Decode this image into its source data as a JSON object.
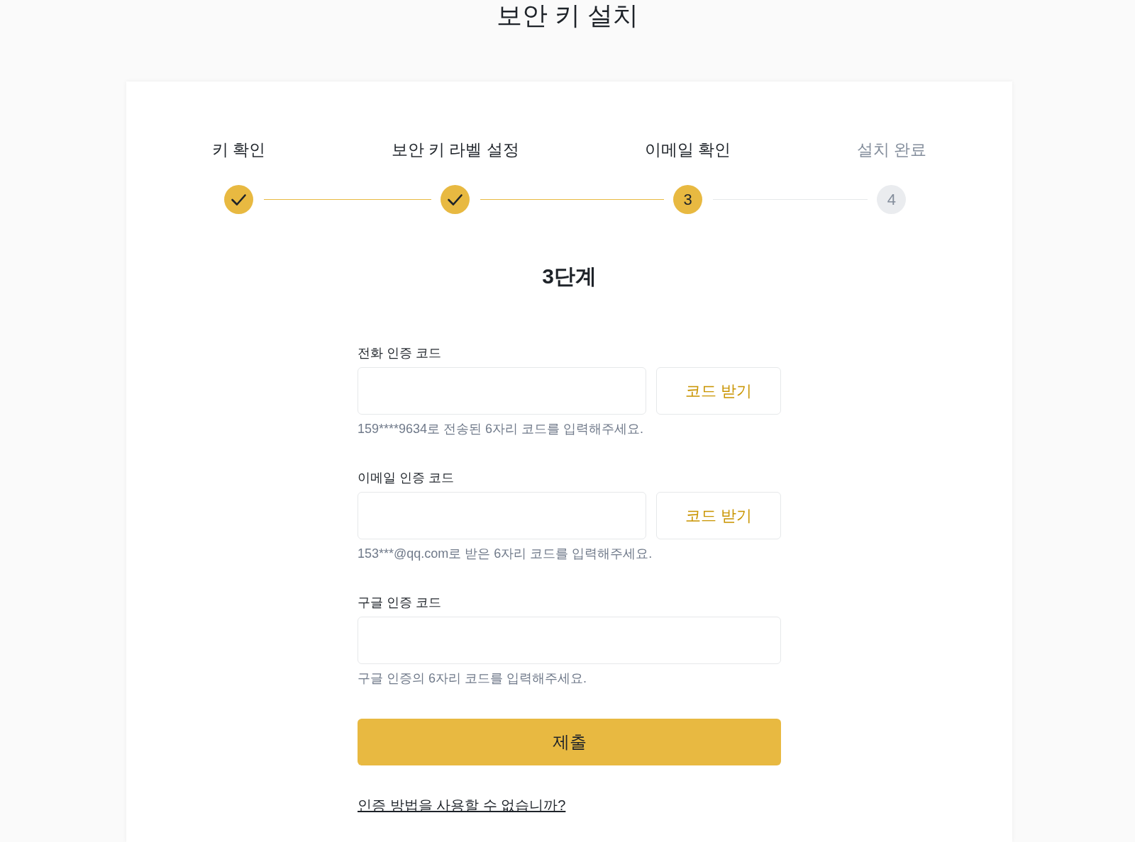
{
  "title": "보안 키 설치",
  "steps": [
    {
      "label": "키 확인",
      "kind": "done"
    },
    {
      "label": "보안 키 라벨 설정",
      "kind": "done"
    },
    {
      "label": "이메일 확인",
      "kind": "current",
      "number": "3"
    },
    {
      "label": "설치 완료",
      "kind": "upcoming",
      "number": "4"
    }
  ],
  "step_heading": "3단계",
  "fields": [
    {
      "label": "전화 인증 코드",
      "button": "코드 받기",
      "hint": "159****9634로 전송된 6자리 코드를 입력해주세요."
    },
    {
      "label": "이메일 인증 코드",
      "button": "코드 받기",
      "hint": "153***@qq.com로 받은 6자리 코드를 입력해주세요."
    },
    {
      "label": "구글 인증 코드",
      "hint": "구글 인증의 6자리 코드를 입력해주세요."
    }
  ],
  "submit": "제출",
  "help_link": "인증 방법을 사용할 수 없습니까?"
}
